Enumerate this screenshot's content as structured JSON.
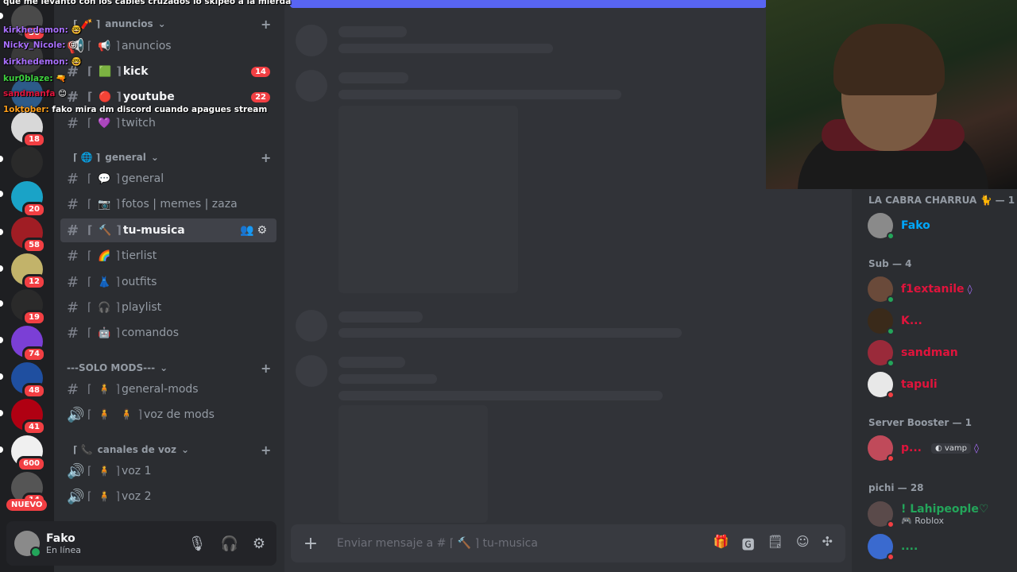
{
  "servers": [
    {
      "badge": "36",
      "color": "#4a4a4a"
    },
    {
      "badge": "",
      "color": "#3a3a3a"
    },
    {
      "badge": "",
      "color": "#2d5b8a"
    },
    {
      "badge": "18",
      "color": "#d8d8d8"
    },
    {
      "badge": "",
      "color": "#2a2a2a"
    },
    {
      "badge": "20",
      "color": "#1aa3c7"
    },
    {
      "badge": "58",
      "color": "#a01d24"
    },
    {
      "badge": "12",
      "color": "#c2b36a"
    },
    {
      "badge": "19",
      "color": "#2a2a2a"
    },
    {
      "badge": "74",
      "color": "#7b3fd6"
    },
    {
      "badge": "48",
      "color": "#1f4fa0"
    },
    {
      "badge": "41",
      "color": "#b00012"
    },
    {
      "badge": "600",
      "color": "#f0f0f0"
    },
    {
      "badge": "14",
      "color": "#555555"
    }
  ],
  "nuevo_label": "NUEVO",
  "categories": {
    "anuncios": "anuncios",
    "general": "general",
    "solo_mods": "---SOLO MODS---",
    "canales_voz": "canales de voz"
  },
  "channels": {
    "anuncios": {
      "name": "anuncios"
    },
    "kick": {
      "name": "kick",
      "count": "14"
    },
    "youtube": {
      "name": "youtube",
      "count": "22"
    },
    "twitch": {
      "name": "twitch"
    },
    "general": {
      "name": "general"
    },
    "fotos": {
      "name": "fotos | memes | zaza"
    },
    "tu_musica": {
      "name": "tu-musica"
    },
    "tierlist": {
      "name": "tierlist"
    },
    "outfits": {
      "name": "outfits"
    },
    "playlist": {
      "name": "playlist"
    },
    "comandos": {
      "name": "comandos"
    },
    "general_mods": {
      "name": "general-mods"
    },
    "voz_mods": {
      "name": "voz de mods"
    },
    "voz1": {
      "name": "voz 1"
    },
    "voz2": {
      "name": "voz 2"
    }
  },
  "user": {
    "name": "Fako",
    "status": "En línea"
  },
  "composer": {
    "placeholder": "Enviar mensaje a # ⌈ 🔨 ⌉ tu-musica"
  },
  "members": {
    "groups": [
      {
        "label": "LA CABRA CHARRUA 🐈 — 1"
      },
      {
        "label": "Sub — 4"
      },
      {
        "label": "Server Booster — 1"
      },
      {
        "label": "pichi — 28"
      }
    ],
    "list": [
      {
        "name": "Fako",
        "color": "#00a8fc"
      },
      {
        "name": "f1extanile",
        "color": "#e0143c"
      },
      {
        "name": "K...",
        "color": "#e0143c"
      },
      {
        "name": "sandman",
        "color": "#e0143c"
      },
      {
        "name": "tapuli",
        "color": "#e0143c"
      },
      {
        "name": "p...",
        "color": "#e0143c",
        "tag": "vamp"
      },
      {
        "name": "! Lahipeople♡",
        "color": "#23a55a",
        "activity": "Roblox"
      },
      {
        "name": "....",
        "color": "#23a55a"
      }
    ]
  },
  "overlay": [
    {
      "user": "",
      "text": "que me levanto con los cables cruzados lo skipeo a la mierda",
      "color": "#ffffff"
    },
    {
      "user": "kirkhedemon:",
      "text": "",
      "color": "#a970ff"
    },
    {
      "user": "Nicky_Nicole:",
      "text": "",
      "color": "#a970ff"
    },
    {
      "user": "kirkhedemon:",
      "text": "",
      "color": "#a970ff"
    },
    {
      "user": "kur0blaze:",
      "text": "",
      "color": "#3fd13f"
    },
    {
      "user": "sandmanfa",
      "text": "",
      "color": "#e0143c"
    },
    {
      "user": "1oktober:",
      "text": "fako mira dm discord cuando apagues stream",
      "color": "#ff9f1a"
    }
  ]
}
